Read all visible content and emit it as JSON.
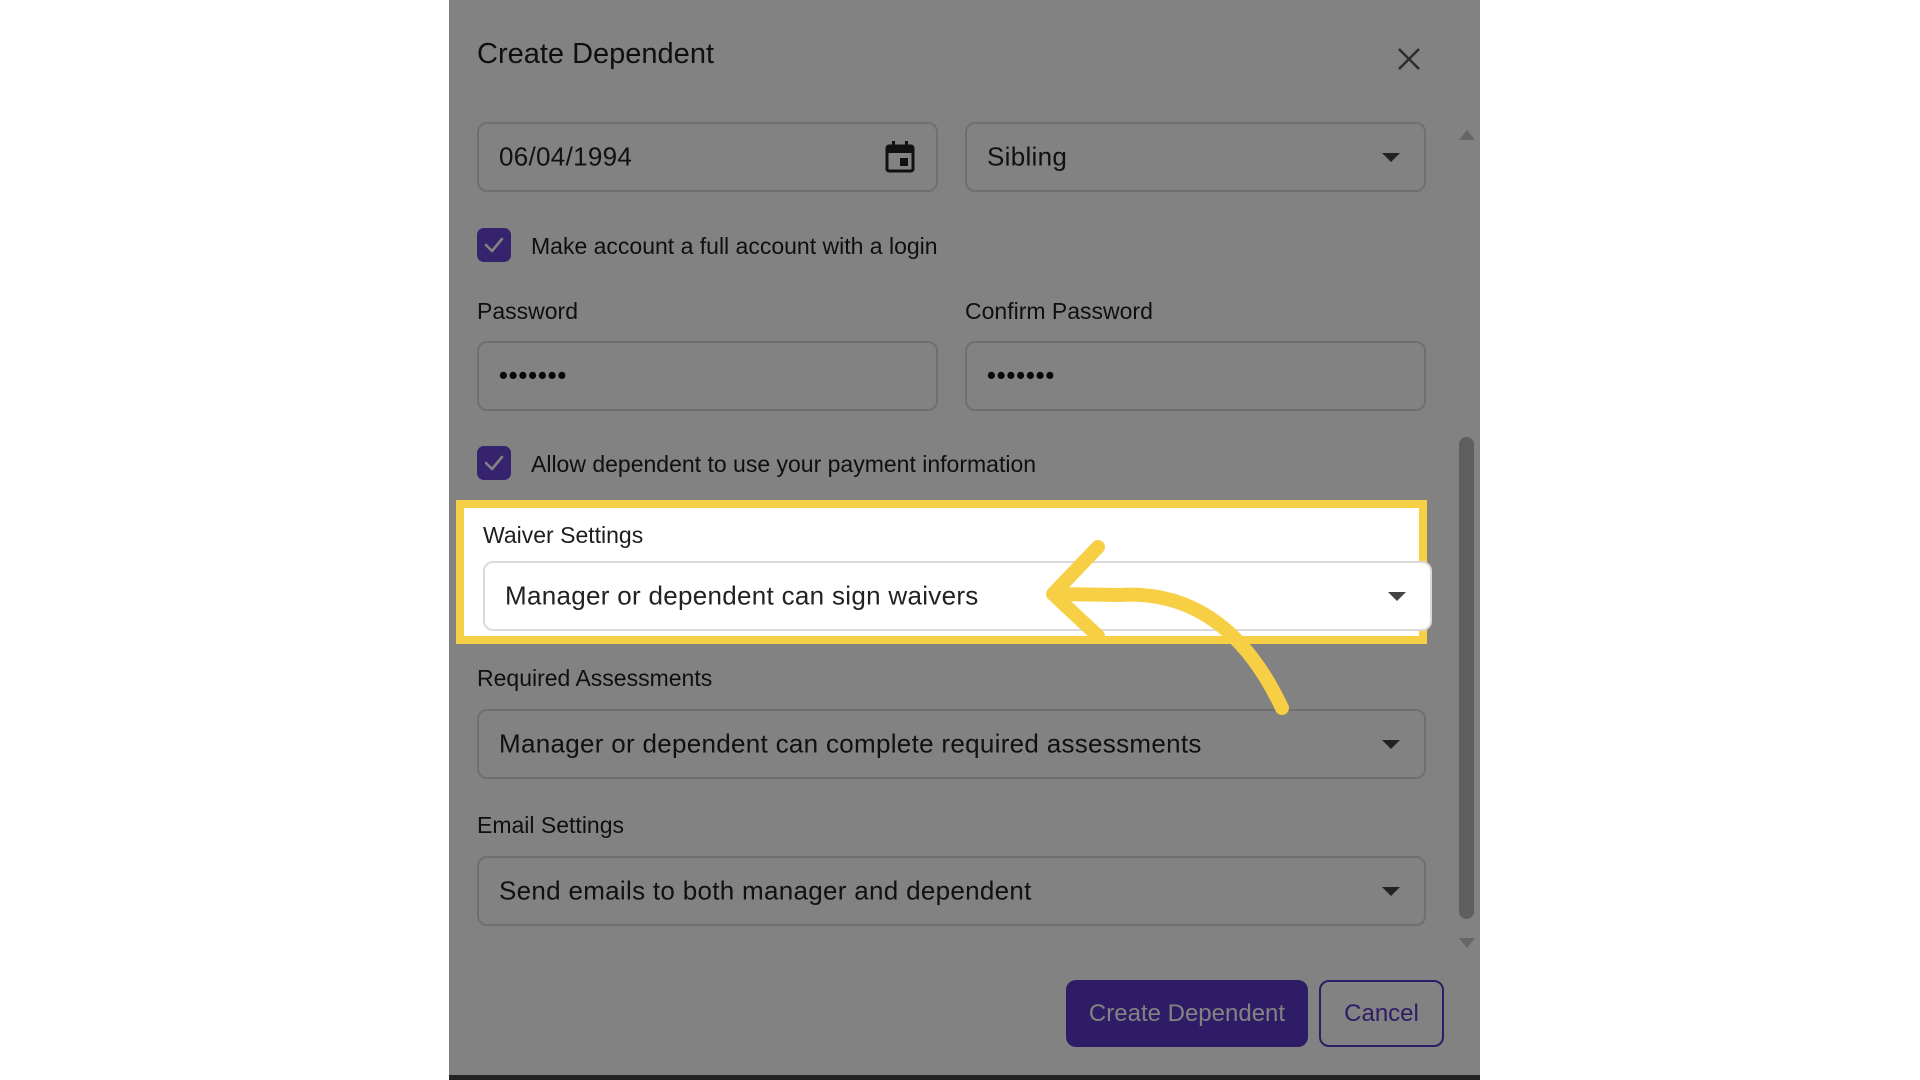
{
  "modal": {
    "title": "Create Dependent"
  },
  "form": {
    "birthdate_value": "06/04/1994",
    "relationship_value": "Sibling",
    "full_account_label": "Make account a full account with a login",
    "full_account_checked": true,
    "password_label": "Password",
    "password_value": "•••••••",
    "confirm_password_label": "Confirm Password",
    "confirm_password_value": "•••••••",
    "payment_info_label": "Allow dependent to use your payment information",
    "payment_info_checked": true,
    "waiver_label": "Waiver Settings",
    "waiver_value": "Manager or dependent can sign waivers",
    "assessments_label": "Required Assessments",
    "assessments_value": "Manager or dependent can complete required assessments",
    "email_label": "Email Settings",
    "email_value": "Send emails to both manager and dependent"
  },
  "actions": {
    "create_label": "Create Dependent",
    "cancel_label": "Cancel"
  },
  "colors": {
    "accent": "#5a37c9",
    "checkbox": "#6a45d7",
    "highlight": "#f7cf45",
    "dim_overlay": "rgba(0,0,0,0.49)"
  },
  "icons": {
    "close": "close-icon",
    "calendar": "calendar-icon",
    "dropdown": "chevron-down-icon",
    "check": "check-icon",
    "annotation_arrow": "curved-arrow-icon"
  }
}
